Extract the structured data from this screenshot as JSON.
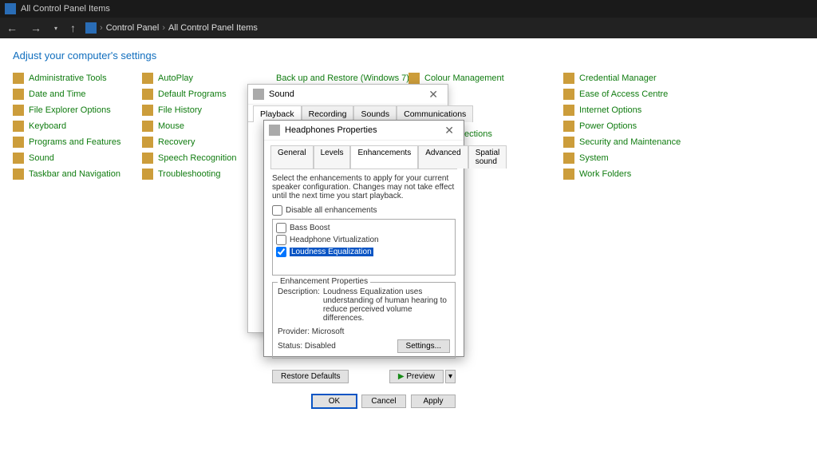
{
  "window": {
    "title": "All Control Panel Items"
  },
  "breadcrumb": {
    "root": "Control Panel",
    "sep": "›",
    "current": "All Control Panel Items"
  },
  "header": {
    "heading": "Adjust your computer's settings"
  },
  "cols": {
    "c1": [
      "Administrative Tools",
      "Date and Time",
      "File Explorer Options",
      "Keyboard",
      "Programs and Features",
      "Sound",
      "Taskbar and Navigation"
    ],
    "c2": [
      "AutoPlay",
      "Default Programs",
      "File History",
      "Mouse",
      "Recovery",
      "Speech Recognition",
      "Troubleshooting"
    ],
    "c3": [
      "Back up and Restore (Windows 7)"
    ],
    "c4": [
      "Colour Management"
    ],
    "c5": [
      "Credential Manager",
      "Ease of Access Centre",
      "Internet Options",
      "Power Options",
      "Security and Maintenance",
      "System",
      "Work Folders"
    ]
  },
  "c5suffix": "ections",
  "sound": {
    "title": "Sound",
    "tabs": [
      "Playback",
      "Recording",
      "Sounds",
      "Communications"
    ]
  },
  "hp": {
    "title": "Headphones Properties",
    "tabs": [
      "General",
      "Levels",
      "Enhancements",
      "Advanced",
      "Spatial sound"
    ],
    "instr": "Select the enhancements to apply for your current speaker configuration. Changes may not take effect until the next time you start playback.",
    "disableAll": "Disable all enhancements",
    "enh": {
      "bass": "Bass Boost",
      "virt": "Headphone Virtualization",
      "loud": "Loudness Equalization"
    },
    "propsLabel": "Enhancement Properties",
    "descLabel": "Description:",
    "desc": "Loudness Equalization uses understanding of human hearing to reduce perceived volume differences.",
    "providerLabel": "Provider:",
    "provider": "Microsoft",
    "statusLabel": "Status:",
    "status": "Disabled",
    "settings": "Settings...",
    "restore": "Restore Defaults",
    "preview": "Preview",
    "ok": "OK",
    "cancel": "Cancel",
    "apply": "Apply"
  }
}
